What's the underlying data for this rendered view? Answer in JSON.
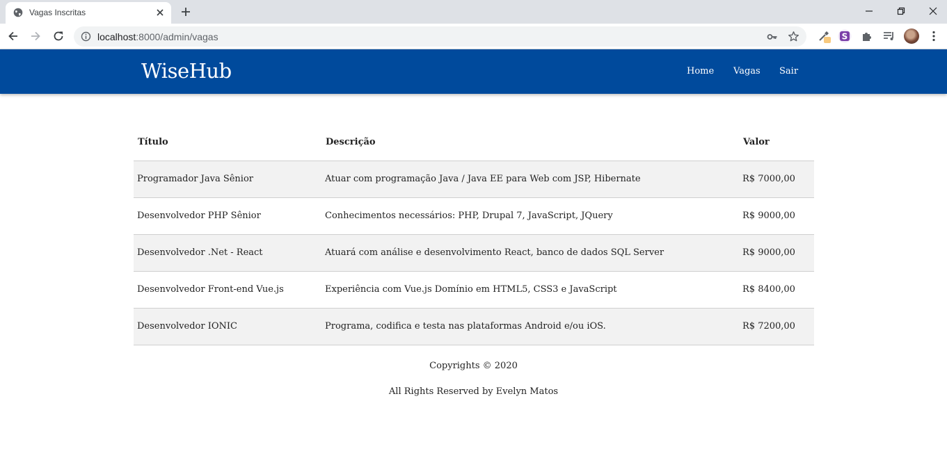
{
  "browser": {
    "tab_title": "Vagas Inscritas",
    "url_host": "localhost",
    "url_rest": ":8000/admin/vagas",
    "extension_s_label": "S"
  },
  "site": {
    "brand": "WiseHub",
    "nav": [
      {
        "label": "Home"
      },
      {
        "label": "Vagas"
      },
      {
        "label": "Sair"
      }
    ]
  },
  "table": {
    "headers": [
      "Título",
      "Descrição",
      "Valor"
    ],
    "rows": [
      {
        "titulo": "Programador Java Sênior",
        "descricao": "Atuar com programação Java / Java EE para Web com JSP, Hibernate",
        "valor": "R$ 7000,00"
      },
      {
        "titulo": "Desenvolvedor PHP Sênior",
        "descricao": "Conhecimentos necessários: PHP, Drupal 7, JavaScript, JQuery",
        "valor": "R$ 9000,00"
      },
      {
        "titulo": "Desenvolvedor .Net - React",
        "descricao": "Atuará com análise e desenvolvimento React, banco de dados SQL Server",
        "valor": "R$ 9000,00"
      },
      {
        "titulo": "Desenvolvedor Front-end Vue.js",
        "descricao": "Experiência com Vue.js Domínio em HTML5, CSS3 e JavaScript",
        "valor": "R$ 8400,00"
      },
      {
        "titulo": "Desenvolvedor IONIC",
        "descricao": "Programa, codifica e testa nas plataformas Android e/ou iOS.",
        "valor": "R$ 7200,00"
      }
    ]
  },
  "footer": {
    "copyright": "Copyrights © 2020",
    "rights": "All Rights Reserved by Evelyn Matos"
  },
  "colors": {
    "header_bg": "#004a9c",
    "row_stripe": "#f2f2f2"
  }
}
